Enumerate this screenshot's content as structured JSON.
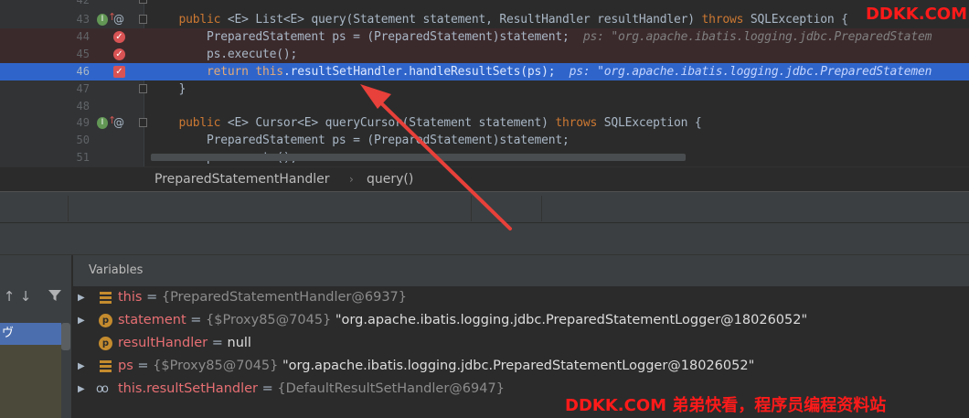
{
  "editor": {
    "lines": [
      {
        "num": "42",
        "code": []
      },
      {
        "num": "43",
        "code": [
          {
            "t": "    "
          },
          {
            "t": "public",
            "c": "kw"
          },
          {
            "t": " <E> List<E> query(Statement statement, ResultHandler resultHandler) "
          },
          {
            "t": "throws",
            "c": "kw"
          },
          {
            "t": " SQLException { "
          }
        ]
      },
      {
        "num": "44",
        "code": [
          {
            "t": "        PreparedStatement ps = (PreparedStatement)statement;  "
          },
          {
            "t": "ps: \"org.apache.ibatis.logging.jdbc.PreparedStatem",
            "c": "cm"
          }
        ]
      },
      {
        "num": "45",
        "code": [
          {
            "t": "        ps.execute();"
          }
        ]
      },
      {
        "num": "46",
        "code": [
          {
            "t": "        "
          },
          {
            "t": "return",
            "c": "kw"
          },
          {
            "t": " "
          },
          {
            "t": "this",
            "c": "kw"
          },
          {
            "t": ".resultSetHandler.handleResultSets(ps);  "
          },
          {
            "t": "ps: \"org.apache.ibatis.logging.jdbc.PreparedStatemen",
            "c": "cm"
          }
        ]
      },
      {
        "num": "47",
        "code": [
          {
            "t": "    }"
          }
        ]
      },
      {
        "num": "48",
        "code": []
      },
      {
        "num": "49",
        "code": [
          {
            "t": "    "
          },
          {
            "t": "public",
            "c": "kw"
          },
          {
            "t": " <E> Cursor<E> queryCursor(Statement statement) "
          },
          {
            "t": "throws",
            "c": "kw"
          },
          {
            "t": " SQLException {"
          }
        ]
      },
      {
        "num": "50",
        "code": [
          {
            "t": "        PreparedStatement ps = (PreparedStatement)statement;"
          }
        ]
      },
      {
        "num": "51",
        "code": [
          {
            "t": "        ps.execute();"
          }
        ]
      }
    ],
    "watermark": "DDKK.COM"
  },
  "breadcrumb": {
    "items": [
      "PreparedStatementHandler",
      "query()"
    ],
    "separator": "›"
  },
  "frames": {
    "selected_label": "ヴ"
  },
  "variables": {
    "title": "Variables",
    "rows": [
      {
        "icon": "field-icon",
        "expandable": true,
        "name": "this",
        "eq": " = ",
        "type": "{PreparedStatementHandler@6937}",
        "value": ""
      },
      {
        "icon": "parameter-icon",
        "expandable": true,
        "name": "statement",
        "eq": " = ",
        "type": "{$Proxy85@7045}",
        "value": " \"org.apache.ibatis.logging.jdbc.PreparedStatementLogger@18026052\""
      },
      {
        "icon": "parameter-icon",
        "expandable": false,
        "name": "resultHandler",
        "eq": " = ",
        "type": "",
        "value": "null"
      },
      {
        "icon": "field-icon",
        "expandable": true,
        "name": "ps",
        "eq": " = ",
        "type": "{$Proxy85@7045}",
        "value": " \"org.apache.ibatis.logging.jdbc.PreparedStatementLogger@18026052\""
      },
      {
        "icon": "watch-icon",
        "expandable": true,
        "name": "this.resultSetHandler",
        "eq": " = ",
        "type": "{DefaultResultSetHandler@6947}",
        "value": ""
      }
    ]
  },
  "watermark_bottom": "DDKK.COM 弟弟快看，程序员编程资料站",
  "colors": {
    "accent": "#2f65ca",
    "breakpoint": "#d95354",
    "keyword": "#cc7832",
    "annotation_arrow": "#e8403a"
  }
}
